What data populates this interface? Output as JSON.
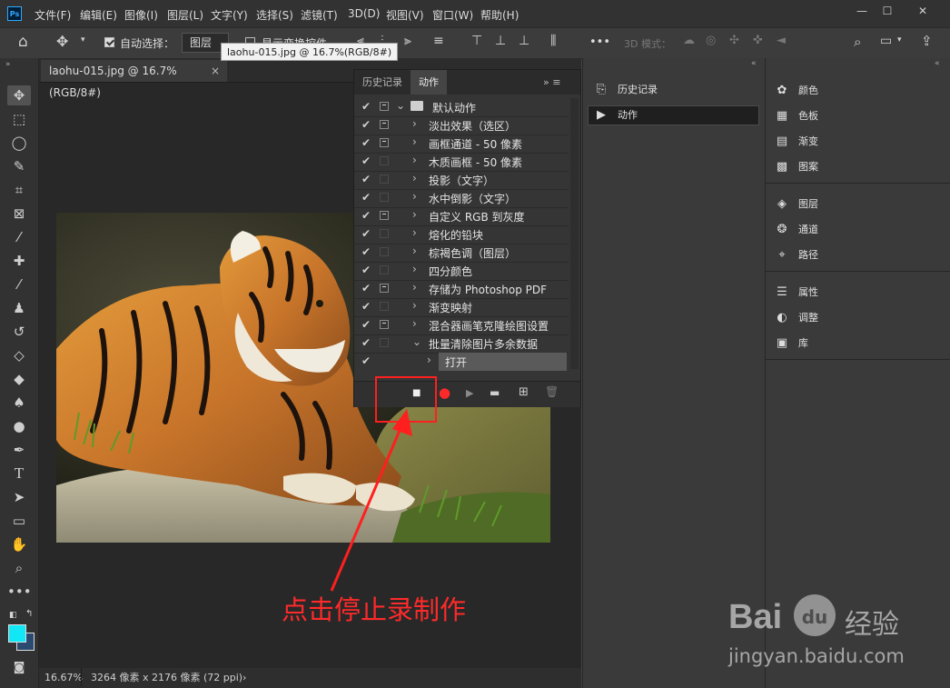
{
  "app": {
    "logo": "Ps"
  },
  "menus": [
    "文件(F)",
    "编辑(E)",
    "图像(I)",
    "图层(L)",
    "文字(Y)",
    "选择(S)",
    "滤镜(T)",
    "3D(D)",
    "视图(V)",
    "窗口(W)",
    "帮助(H)"
  ],
  "window_controls": {
    "minimize": "—",
    "maximize": "☐",
    "close": "✕"
  },
  "options_bar": {
    "auto_select_label": "自动选择：",
    "auto_select_checked": true,
    "auto_select_value": "图层",
    "show_transform_label": "显示变换控件",
    "mode_3d_label": "3D 模式：",
    "more": "•••"
  },
  "document": {
    "tab_title": "laohu-015.jpg @ 16.7%(RGB/8#)",
    "tab_close": "×",
    "tooltip": "laohu-015.jpg @ 16.7%(RGB/8#)",
    "zoom": "16.67%",
    "info": "3264 像素 x 2176 像素 (72 ppi)",
    "status_arrow": "›"
  },
  "colors": {
    "foreground": "#12e8f5",
    "background": "#2b4a6f",
    "accent_red": "#ff2a2a"
  },
  "actions_panel": {
    "tabs": [
      "历史记录",
      "动作"
    ],
    "active_tab": 1,
    "menu_glyph": "»  ≡",
    "set_name": "默认动作",
    "actions": [
      {
        "label": "淡出效果（选区）",
        "dialog": true
      },
      {
        "label": "画框通道 - 50 像素",
        "dialog": true
      },
      {
        "label": "木质画框 - 50 像素",
        "dialog": false
      },
      {
        "label": "投影（文字）",
        "dialog": false
      },
      {
        "label": "水中倒影（文字）",
        "dialog": false
      },
      {
        "label": "自定义 RGB 到灰度",
        "dialog": true
      },
      {
        "label": "熔化的铅块",
        "dialog": false
      },
      {
        "label": "棕褐色调（图层）",
        "dialog": false
      },
      {
        "label": "四分颜色",
        "dialog": false
      },
      {
        "label": "存储为 Photoshop PDF",
        "dialog": true
      },
      {
        "label": "渐变映射",
        "dialog": false
      },
      {
        "label": "混合器画笔克隆绘图设置",
        "dialog": true
      },
      {
        "label": "批量清除图片多余数据",
        "dialog": false
      }
    ],
    "recorded_step": "打开",
    "footer": {
      "stop": "■",
      "record": "●",
      "play": "▶",
      "folder": "▬",
      "new": "⊞",
      "delete": "🗑"
    }
  },
  "dock_left": [
    {
      "icon": "history-icon",
      "glyph": "⎘",
      "label": "历史记录",
      "active": false
    },
    {
      "icon": "actions-icon",
      "glyph": "▶",
      "label": "动作",
      "active": true
    }
  ],
  "dock_right": {
    "group1": [
      {
        "icon": "palette-icon",
        "glyph": "✿",
        "label": "颜色"
      },
      {
        "icon": "swatches-icon",
        "glyph": "▦",
        "label": "色板"
      },
      {
        "icon": "gradient-icon",
        "glyph": "▤",
        "label": "渐变"
      },
      {
        "icon": "pattern-icon",
        "glyph": "▩",
        "label": "图案"
      }
    ],
    "group2": [
      {
        "icon": "layers-icon",
        "glyph": "◈",
        "label": "图层"
      },
      {
        "icon": "channels-icon",
        "glyph": "❂",
        "label": "通道"
      },
      {
        "icon": "paths-icon",
        "glyph": "⌖",
        "label": "路径"
      }
    ],
    "group3": [
      {
        "icon": "properties-icon",
        "glyph": "☰",
        "label": "属性"
      },
      {
        "icon": "adjustments-icon",
        "glyph": "◐",
        "label": "调整"
      },
      {
        "icon": "libraries-icon",
        "glyph": "▣",
        "label": "库"
      }
    ]
  },
  "annotation": {
    "text": "点击停止录制作"
  },
  "watermark": {
    "brand_left": "Bai",
    "brand_right": "经验",
    "paw": "du",
    "url": "jingyan.baidu.com"
  }
}
